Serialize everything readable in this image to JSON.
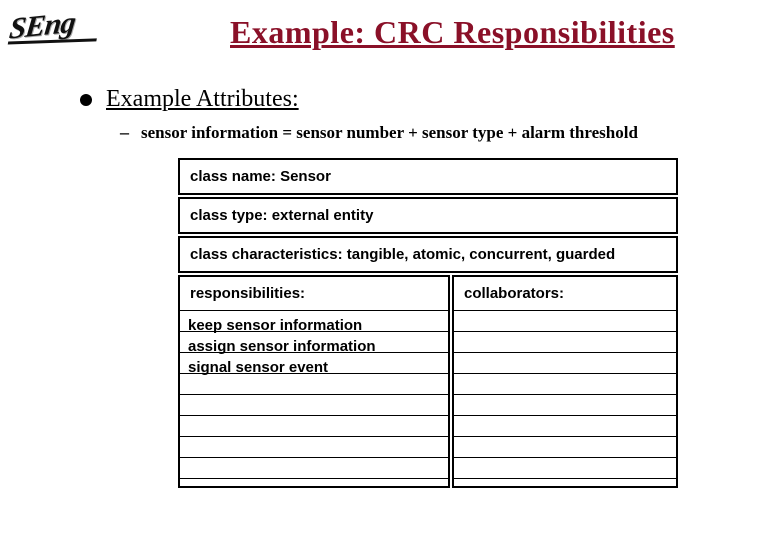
{
  "logo": {
    "text": "SEng"
  },
  "title": "Example: CRC Responsibilities",
  "bullet": {
    "text": "Example Attributes:"
  },
  "sub": {
    "text": "sensor information = sensor number + sensor type + alarm threshold"
  },
  "card": {
    "class_name_label": "class name:",
    "class_name_value": "Sensor",
    "class_type_label": "class type:",
    "class_type_value": "external entity",
    "class_char_label": "class characteristics:",
    "class_char_value": "tangible, atomic, concurrent, guarded",
    "responsibilities_label": "responsibilities:",
    "collaborators_label": "collaborators:",
    "responsibilities": {
      "r1": "keep sensor information",
      "r2": "assign sensor information",
      "r3": "signal sensor event"
    }
  }
}
